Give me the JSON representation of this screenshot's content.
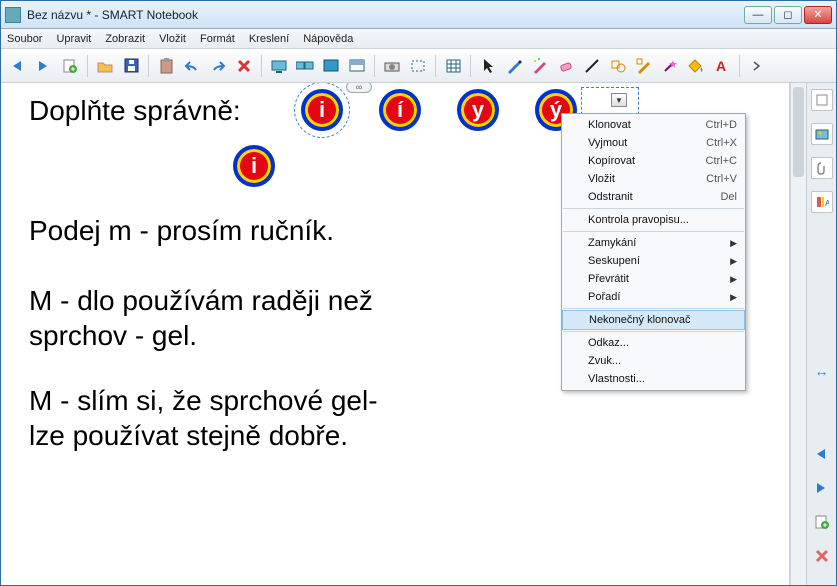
{
  "window": {
    "title": "Bez názvu * - SMART Notebook"
  },
  "menubar": [
    "Soubor",
    "Upravit",
    "Zobrazit",
    "Vložit",
    "Formát",
    "Kreslení",
    "Nápověda"
  ],
  "canvas": {
    "heading": "Doplňte správně:",
    "circles": [
      {
        "letter": "i"
      },
      {
        "letter": "í"
      },
      {
        "letter": "y"
      },
      {
        "letter": "ý"
      },
      {
        "letter": "i"
      }
    ],
    "ex1": "Podej m -   prosím ručník.",
    "ex2a": "M - dlo  používám raději než",
    "ex2b": "sprchov -   gel.",
    "ex3a": "M - slím  si, že sprchové gel-",
    "ex3b": "lze používat stejně dobře."
  },
  "context_menu": {
    "items": [
      {
        "label": "Klonovat",
        "shortcut": "Ctrl+D"
      },
      {
        "label": "Vyjmout",
        "shortcut": "Ctrl+X"
      },
      {
        "label": "Kopírovat",
        "shortcut": "Ctrl+C"
      },
      {
        "label": "Vložit",
        "shortcut": "Ctrl+V"
      },
      {
        "label": "Odstranit",
        "shortcut": "Del"
      }
    ],
    "spell": "Kontrola pravopisu...",
    "submenu": [
      {
        "label": "Zamykání"
      },
      {
        "label": "Seskupení"
      },
      {
        "label": "Převrátit"
      },
      {
        "label": "Pořadí"
      }
    ],
    "infclone": "Nekonečný klonovač",
    "tail": [
      "Odkaz...",
      "Zvuk...",
      "Vlastnosti..."
    ]
  },
  "icons": {
    "back": "back-icon",
    "fwd": "forward-icon",
    "newpage": "new-page-icon",
    "open": "open-icon",
    "save": "save-icon",
    "paste": "paste-icon",
    "undo": "undo-icon",
    "redo": "redo-icon",
    "delete": "delete-icon",
    "screen": "screen-icon",
    "dual": "dual-screen-icon",
    "full": "fullscreen-icon",
    "camera": "camera-icon",
    "capture": "screen-capture-icon",
    "table": "table-icon",
    "pointer": "pointer-icon",
    "pen": "pen-icon",
    "creative": "creative-pen-icon",
    "eraser": "eraser-icon",
    "line": "line-icon",
    "shape": "shape-icon",
    "recog": "shape-recog-icon",
    "magic": "magic-pen-icon",
    "fill": "fill-icon",
    "text": "text-icon",
    "props": "properties-icon"
  }
}
